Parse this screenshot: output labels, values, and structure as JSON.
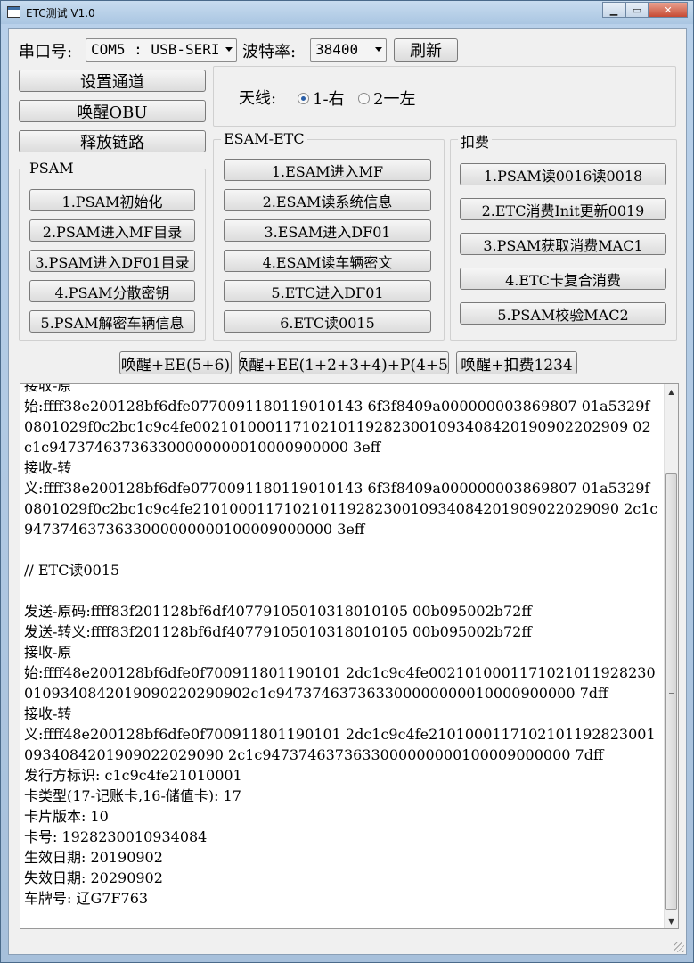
{
  "window": {
    "title": "ETC测试 V1.0",
    "minimize": "▁",
    "maximize": "▭",
    "close": "✕"
  },
  "serial": {
    "port_label": "串口号:",
    "port_value": "COM5 : USB-SERI",
    "baud_label": "波特率:",
    "baud_value": "38400",
    "refresh_label": "刷新"
  },
  "buttons": {
    "set_channel": "设置通道",
    "wake_obu": "唤醒OBU",
    "release_link": "释放链路"
  },
  "antenna": {
    "label": "天线:",
    "options": [
      {
        "label": "1-右",
        "selected": true
      },
      {
        "label": "2一左",
        "selected": false
      }
    ]
  },
  "psam": {
    "title": "PSAM",
    "items": [
      "1.PSAM初始化",
      "2.PSAM进入MF目录",
      "3.PSAM进入DF01目录",
      "4.PSAM分散密钥",
      "5.PSAM解密车辆信息"
    ]
  },
  "esam": {
    "title": "ESAM-ETC",
    "items": [
      "1.ESAM进入MF",
      "2.ESAM读系统信息",
      "3.ESAM进入DF01",
      "4.ESAM读车辆密文",
      "5.ETC进入DF01",
      "6.ETC读0015"
    ]
  },
  "deduct": {
    "title": "扣费",
    "items": [
      "1.PSAM读0016读0018",
      "2.ETC消费Init更新0019",
      "3.PSAM获取消费MAC1",
      "4.ETC卡复合消费",
      "5.PSAM校验MAC2"
    ]
  },
  "combo_buttons": [
    "唤醒+EE(5+6)",
    "唤醒+EE(1+2+3+4)+P(4+5)",
    "唤醒+扣费1234"
  ],
  "log": {
    "text": "接收-原\n始:ffff38e200128bf6dfe0770091180119010143 6f3f8409a000000003869807 01a5329f0801029f0c2bc1c9c4fe002101000117102101192823001093408420190902202909 02c1c947374637363300000000010000900000 3eff\n接收-转\n义:ffff38e200128bf6dfe0770091180119010143 6f3f8409a000000003869807 01a5329f0801029f0c2bc1c9c4fe21010001171021011928230010934084201909022029090 2c1c9473746373633000000000100009000000 3eff\n\n// ETC读0015\n\n发送-原码:ffff83f201128bf6df40779105010318010105 00b095002b72ff\n发送-转义:ffff83f201128bf6df40779105010318010105 00b095002b72ff\n接收-原\n始:ffff48e200128bf6dfe0f700911801190101 2dc1c9c4fe00210100011710210119282300109340842019090220290902c1c947374637363300000000010000900000 7dff\n接收-转\n义:ffff48e200128bf6dfe0f700911801190101 2dc1c9c4fe21010001171021011928230010934084201909022029090 2c1c9473746373633000000000100009000000 7dff\n发行方标识: c1c9c4fe21010001\n卡类型(17-记账卡,16-储值卡): 17\n卡片版本: 10\n卡号: 1928230010934084\n生效日期: 20190902\n失效日期: 20290902\n车牌号: 辽G7F763"
  }
}
